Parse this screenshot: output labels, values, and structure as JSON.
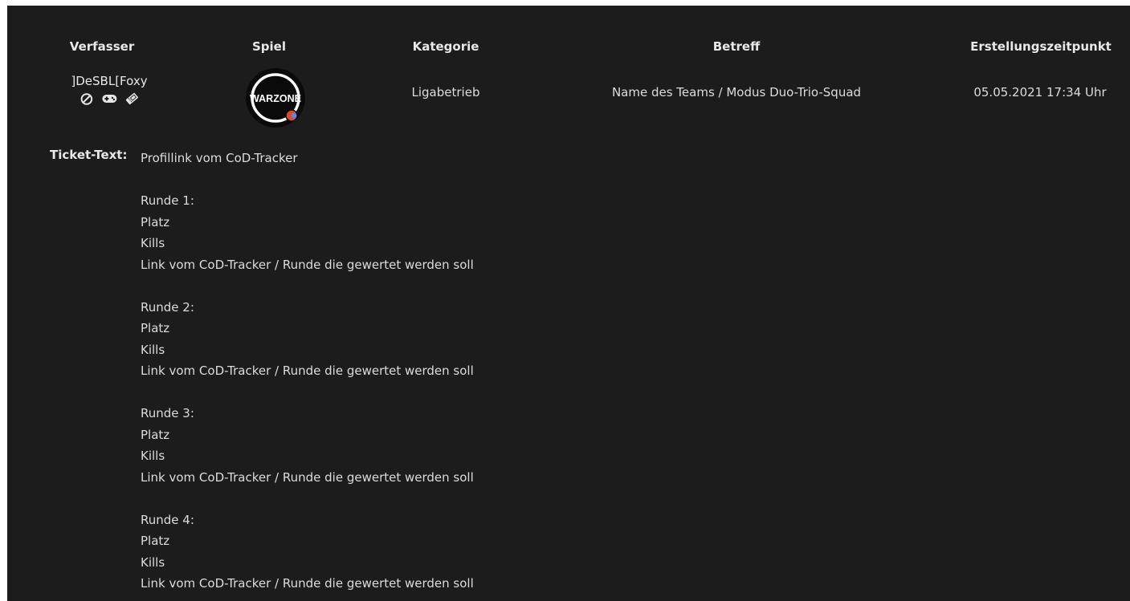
{
  "table": {
    "headers": {
      "author": "Verfasser",
      "game": "Spiel",
      "category": "Kategorie",
      "subject": "Betreff",
      "created": "Erstellungszeitpunkt"
    },
    "row": {
      "author": "]DeSBL[Foxy",
      "author_icons": [
        "ban-icon",
        "gamepad-icon",
        "ticket-icon"
      ],
      "game_logo_text": "WARZONE",
      "category": "Ligabetrieb",
      "subject": "Name des Teams / Modus Duo-Trio-Squad",
      "created": "05.05.2021 17:34 Uhr"
    }
  },
  "ticket": {
    "label": "Ticket-Text:",
    "intro": "Profillink vom CoD-Tracker",
    "rounds": [
      {
        "title": "Runde 1:",
        "place": "Platz",
        "kills": "Kills",
        "link": "Link vom CoD-Tracker / Runde die gewertet werden soll"
      },
      {
        "title": "Runde 2:",
        "place": "Platz",
        "kills": "Kills",
        "link": "Link vom CoD-Tracker / Runde die gewertet werden soll"
      },
      {
        "title": "Runde 3:",
        "place": "Platz",
        "kills": "Kills",
        "link": "Link vom CoD-Tracker / Runde die gewertet werden soll"
      },
      {
        "title": "Runde 4:",
        "place": "Platz",
        "kills": "Kills",
        "link": "Link vom CoD-Tracker / Runde die gewertet werden soll"
      }
    ]
  },
  "colors": {
    "background": "#1c1c1c",
    "text": "#dcdcdc",
    "logo_ring": "#ffffff",
    "logo_dot": "#e0462a"
  }
}
